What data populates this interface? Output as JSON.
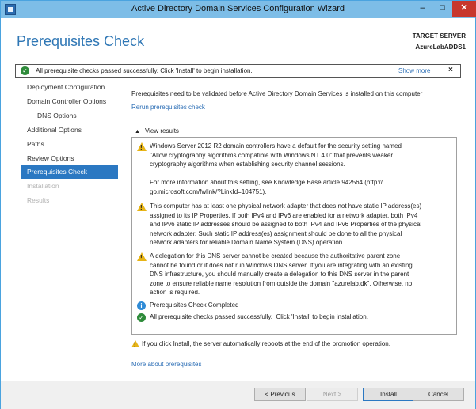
{
  "window": {
    "title": "Active Directory Domain Services Configuration Wizard",
    "min_label": "–",
    "max_label": "□",
    "close_label": "✕"
  },
  "header": {
    "page_title": "Prerequisites Check",
    "target_label": "TARGET SERVER",
    "target_name": "AzureLabADDS1"
  },
  "banner": {
    "message": "All prerequisite checks passed successfully.  Click 'Install' to begin installation.",
    "show_more": "Show more",
    "close": "×"
  },
  "nav": {
    "items": [
      {
        "label": "Deployment Configuration",
        "state": "normal"
      },
      {
        "label": "Domain Controller Options",
        "state": "normal"
      },
      {
        "label": "DNS Options",
        "state": "sub"
      },
      {
        "label": "Additional Options",
        "state": "normal"
      },
      {
        "label": "Paths",
        "state": "normal"
      },
      {
        "label": "Review Options",
        "state": "normal"
      },
      {
        "label": "Prerequisites Check",
        "state": "active"
      },
      {
        "label": "Installation",
        "state": "disabled"
      },
      {
        "label": "Results",
        "state": "disabled"
      }
    ]
  },
  "main": {
    "intro": "Prerequisites need to be validated before Active Directory Domain Services is installed on this computer",
    "rerun": "Rerun prerequisites check",
    "view_results": "View results",
    "results": [
      {
        "type": "warning",
        "text": "Windows Server 2012 R2 domain controllers have a default for the security setting named\n\"Allow cryptography algorithms compatible with Windows NT 4.0\" that prevents weaker\ncryptography algorithms when establishing security channel sessions.\n\nFor more information about this setting, see Knowledge Base article 942564 (http://\ngo.microsoft.com/fwlink/?LinkId=104751)."
      },
      {
        "type": "warning",
        "text": "This computer has at least one physical network adapter that does not have static IP address(es)\nassigned to its IP Properties. If both IPv4 and IPv6 are enabled for a network adapter, both IPv4\nand IPv6 static IP addresses should be assigned to both IPv4 and IPv6 Properties of the physical\nnetwork adapter. Such static IP address(es) assignment should be done to all the physical\nnetwork adapters for reliable Domain Name System (DNS) operation."
      },
      {
        "type": "warning",
        "text": "A delegation for this DNS server cannot be created because the authoritative parent zone\ncannot be found or it does not run Windows DNS server. If you are integrating with an existing\nDNS infrastructure, you should manually create a delegation to this DNS server in the parent\nzone to ensure reliable name resolution from outside the domain \"azurelab.dk\". Otherwise, no\naction is required."
      },
      {
        "type": "info",
        "text": "Prerequisites Check Completed"
      },
      {
        "type": "success",
        "text": "All prerequisite checks passed successfully.  Click 'Install' to begin installation."
      }
    ],
    "bottom_warning": "If you click Install, the server automatically reboots at the end of the promotion operation.",
    "more_link": "More about prerequisites"
  },
  "footer": {
    "previous": "< Previous",
    "next": "Next >",
    "install": "Install",
    "cancel": "Cancel"
  }
}
